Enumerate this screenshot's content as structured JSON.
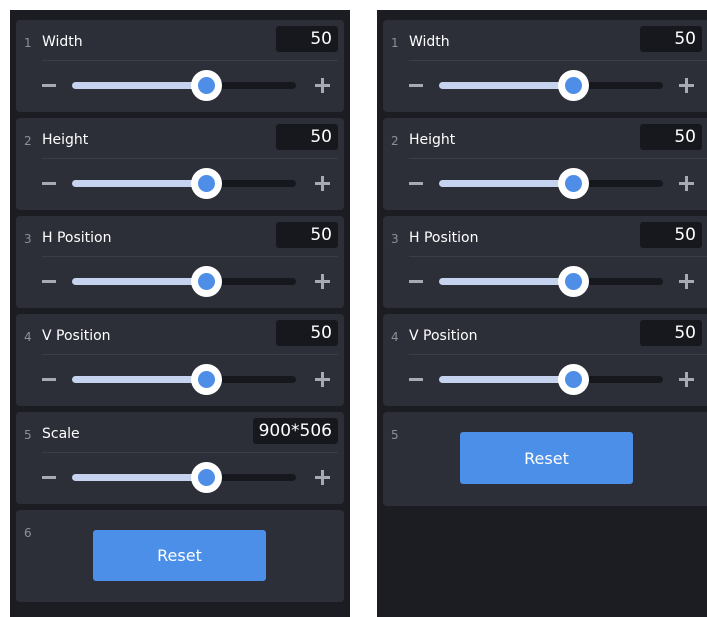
{
  "left_panel": {
    "rows": [
      {
        "index": "1",
        "label": "Width",
        "value": "50",
        "level": 0.6
      },
      {
        "index": "2",
        "label": "Height",
        "value": "50",
        "level": 0.6
      },
      {
        "index": "3",
        "label": "H Position",
        "value": "50",
        "level": 0.6
      },
      {
        "index": "4",
        "label": "V Position",
        "value": "50",
        "level": 0.6
      },
      {
        "index": "5",
        "label": "Scale",
        "value": "900*506",
        "level": 0.6
      }
    ],
    "reset_index": "6",
    "reset_label": "Reset"
  },
  "right_panel": {
    "rows": [
      {
        "index": "1",
        "label": "Width",
        "value": "50",
        "level": 0.6
      },
      {
        "index": "2",
        "label": "Height",
        "value": "50",
        "level": 0.6
      },
      {
        "index": "3",
        "label": "H Position",
        "value": "50",
        "level": 0.6
      },
      {
        "index": "4",
        "label": "V Position",
        "value": "50",
        "level": 0.6
      }
    ],
    "reset_index": "5",
    "reset_label": "Reset"
  },
  "colors": {
    "panel_bg": "#1c1d22",
    "card_bg": "#2d2f38",
    "accent": "#4b8fe8",
    "track_fill": "#c6d3ee"
  }
}
